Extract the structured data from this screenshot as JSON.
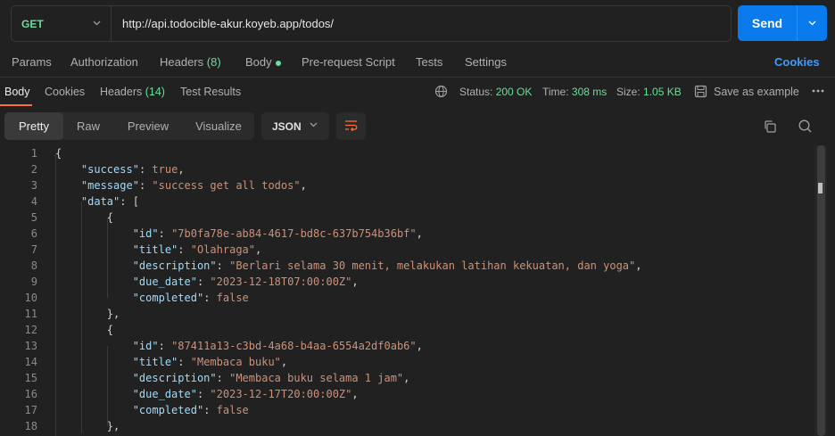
{
  "request": {
    "method": "GET",
    "url": "http://api.todocible-akur.koyeb.app/todos/",
    "send_label": "Send"
  },
  "request_tabs": {
    "params": "Params",
    "authorization": "Authorization",
    "headers": "Headers",
    "headers_count": "(8)",
    "body": "Body",
    "pre_request": "Pre-request Script",
    "tests": "Tests",
    "settings": "Settings",
    "cookies": "Cookies"
  },
  "response_tabs": {
    "body": "Body",
    "cookies": "Cookies",
    "headers": "Headers",
    "headers_count": "(14)",
    "test_results": "Test Results"
  },
  "response_status": {
    "status_label": "Status:",
    "status_value": "200 OK",
    "time_label": "Time:",
    "time_value": "308 ms",
    "size_label": "Size:",
    "size_value": "1.05 KB",
    "save_label": "Save as example"
  },
  "view": {
    "pretty": "Pretty",
    "raw": "Raw",
    "preview": "Preview",
    "visualize": "Visualize",
    "format": "JSON"
  },
  "icons": {
    "method_dropdown": "chevron-down-icon",
    "send_dropdown": "chevron-down-icon",
    "network": "globe-icon",
    "save": "save-icon",
    "more": "more-horizontal-icon",
    "wrap": "wrap-lines-icon",
    "copy": "copy-icon",
    "search": "search-icon"
  },
  "colors": {
    "accent": "#097bed",
    "status_ok": "#6bdd9a",
    "active_tab_underline": "#ff6c37",
    "cookies_link": "#3e9cff"
  },
  "response_body": {
    "line_numbers": [
      "1",
      "2",
      "3",
      "4",
      "5",
      "6",
      "7",
      "8",
      "9",
      "10",
      "11",
      "12",
      "13",
      "14",
      "15",
      "16",
      "17",
      "18"
    ],
    "lines": [
      "{",
      "    \"success\": true,",
      "    \"message\": \"success get all todos\",",
      "    \"data\": [",
      "        {",
      "            \"id\": \"7b0fa78e-ab84-4617-bd8c-637b754b36bf\",",
      "            \"title\": \"Olahraga\",",
      "            \"description\": \"Berlari selama 30 menit, melakukan latihan kekuatan, dan yoga\",",
      "            \"due_date\": \"2023-12-18T07:00:00Z\",",
      "            \"completed\": false",
      "        },",
      "        {",
      "            \"id\": \"87411a13-c3bd-4a68-b4aa-6554a2df0ab6\",",
      "            \"title\": \"Membaca buku\",",
      "            \"description\": \"Membaca buku selama 1 jam\",",
      "            \"due_date\": \"2023-12-17T20:00:00Z\",",
      "            \"completed\": false",
      "        },"
    ]
  }
}
